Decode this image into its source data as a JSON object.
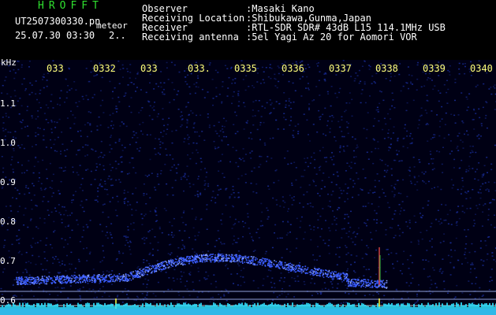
{
  "header": {
    "brand": "HROFFT",
    "filename": "UT2507300330.pn",
    "file_tag": "meteor",
    "datetime": "25.07.30 03:30",
    "count": "2..",
    "rows": [
      {
        "label": "Observer",
        "value": ":Masaki Kano"
      },
      {
        "label": "Receiving Location",
        "value": ":Shibukawa,Gunma,Japan"
      },
      {
        "label": "Receiver",
        "value": ":RTL-SDR SDR# 43dB L15 114.1MHz USB"
      },
      {
        "label": "Receiving antenna",
        "value": ":5el Yagi Az 20 for Aomori VOR"
      }
    ]
  },
  "plot": {
    "y_unit": "kHz",
    "y_ticks": [
      "1.1",
      "1.0",
      "0.9",
      "0.8",
      "0.7",
      "0.6"
    ],
    "x_ticks": [
      "033",
      "0332",
      "033",
      "033.",
      "0335",
      "0336",
      "0337",
      "0338",
      "0339",
      "0340"
    ],
    "colors": {
      "background": "#000014",
      "noise": "#1a2fa0",
      "trace": "#3a5cff",
      "baseline": "#2fe0ff",
      "marker": "#ffff40"
    }
  }
}
